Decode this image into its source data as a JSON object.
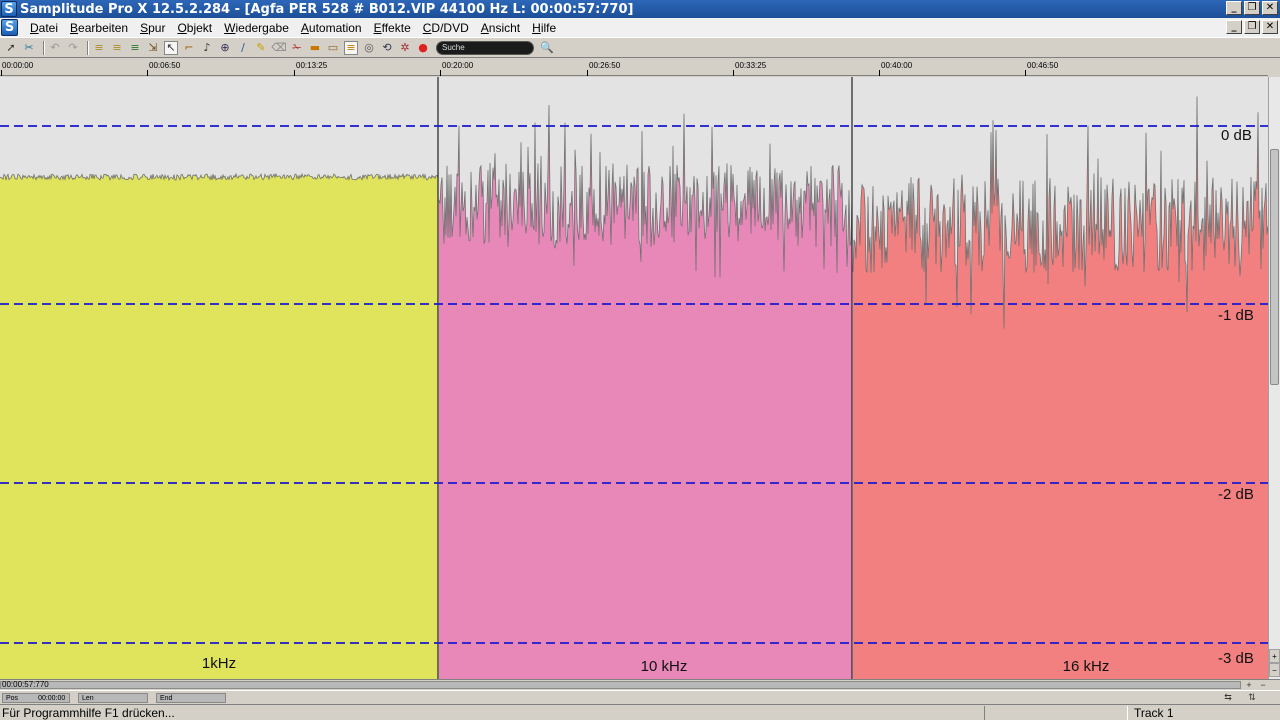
{
  "window": {
    "title": "Samplitude Pro X 12.5.2.284 - [Agfa PER 528 # B012.VIP   44100 Hz L: 00:00:57:770]",
    "app_icon": "S",
    "buttons": [
      "_",
      "❐",
      "✕"
    ]
  },
  "menu": {
    "items": [
      {
        "u": "D",
        "rest": "atei"
      },
      {
        "u": "B",
        "rest": "earbeiten"
      },
      {
        "u": "S",
        "rest": "pur"
      },
      {
        "u": "O",
        "rest": "bjekt"
      },
      {
        "u": "W",
        "rest": "iedergabe"
      },
      {
        "u": "A",
        "rest": "utomation"
      },
      {
        "u": "E",
        "rest": "ffekte"
      },
      {
        "u": "C",
        "rest": "D/DVD"
      },
      {
        "u": "A",
        "rest": "nsicht"
      },
      {
        "u": "H",
        "rest": "ilfe"
      }
    ]
  },
  "toolbar": {
    "search_placeholder": "Suche",
    "icons": [
      "pointer-icon",
      "cut-icon",
      "undo-icon",
      "redo-icon",
      "list-icon",
      "list-icon",
      "list-icon",
      "select-icon",
      "range-icon",
      "pointer-icon",
      "scrub-icon",
      "zoom-icon",
      "draw-icon",
      "pencil-icon",
      "erase-icon",
      "cut-tool-icon",
      "marker-icon",
      "fade-icon",
      "snap-icon",
      "cd-icon",
      "loop-icon",
      "settings-icon",
      "record-icon"
    ]
  },
  "ruler": {
    "labels": [
      "00:00:00",
      "00:06:50",
      "00:13:25",
      "00:20:00",
      "00:26:50",
      "00:33:25",
      "00:40:00",
      "00:46:50"
    ]
  },
  "waveform": {
    "db_labels": [
      "0 dB",
      "-1 dB",
      "-2 dB",
      "-3 dB"
    ],
    "segments": [
      {
        "label": "1kHz",
        "color": "#e0e35c"
      },
      {
        "label": "10 kHz",
        "color": "#e888b8"
      },
      {
        "label": "16 kHz",
        "color": "#f28080"
      }
    ],
    "grid_color": "#1a1ad0",
    "trace_color": "#707070"
  },
  "hscroll": {
    "position": "00:00:57:770"
  },
  "posbar": {
    "pos_label": "Pos",
    "pos_value": "00:00:00",
    "len_label": "Len",
    "end_label": "End"
  },
  "status": {
    "help_text": "Für Programmhilfe F1 drücken...",
    "track": "Track 1"
  }
}
